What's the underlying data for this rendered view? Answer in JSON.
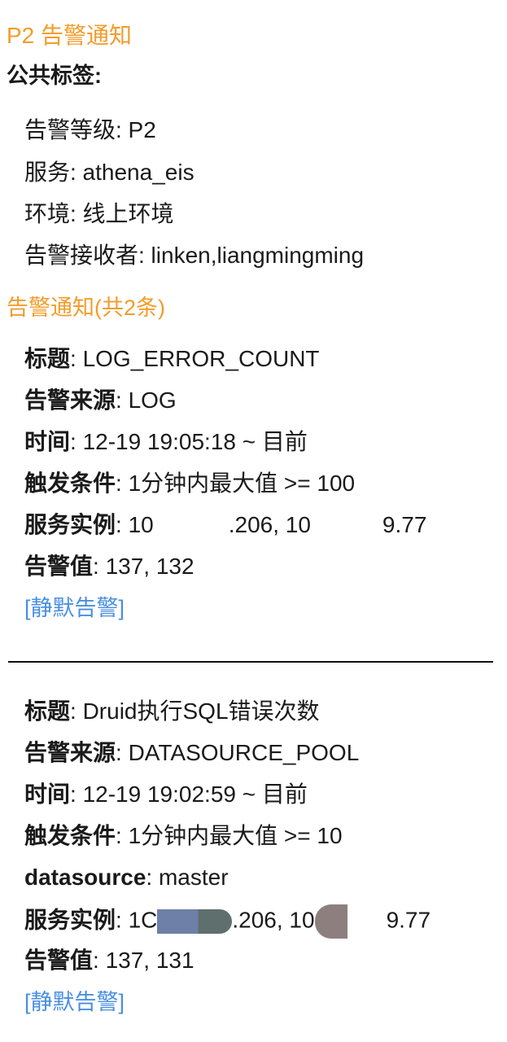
{
  "header": {
    "title": "P2 告警通知",
    "common_labels_heading": "公共标签:"
  },
  "common_labels": {
    "level_key": "告警等级:",
    "level_val": " P2",
    "service_key": "服务:",
    "service_val": " athena_eis",
    "env_key": "环境:",
    "env_val": " 线上环境",
    "receivers_key": "告警接收者:",
    "receivers_val": " linken,liangmingming"
  },
  "alerts_header": "告警通知(共2条)",
  "alerts": [
    {
      "title_key": "标题",
      "title_val": ": LOG_ERROR_COUNT",
      "source_key": "告警来源",
      "source_val": ": LOG",
      "time_key": "时间",
      "time_val": ": 12-19 19:05:18 ~ 目前",
      "cond_key": "触发条件",
      "cond_val": ": 1分钟内最大值 >= 100",
      "inst_key": "服务实例",
      "inst_val_a": ": 10",
      "inst_val_b": ".206, 10",
      "inst_val_c": "9.77",
      "value_key": "告警值",
      "value_val": ": 137, 132",
      "silence": "[静默告警]"
    },
    {
      "title_key": "标题",
      "title_val": ": Druid执行SQL错误次数",
      "source_key": "告警来源",
      "source_val": ": DATASOURCE_POOL",
      "time_key": "时间",
      "time_val": ": 12-19 19:02:59 ~ 目前",
      "cond_key": "触发条件",
      "cond_val": ": 1分钟内最大值 >= 10",
      "ds_key": "datasource",
      "ds_val": ": master",
      "inst_key": "服务实例",
      "inst_val_a": ": 1C",
      "inst_val_b": ".206, 10",
      "inst_val_c": "9.77",
      "value_key": "告警值",
      "value_val": ": 137, 131",
      "silence": "[静默告警]"
    }
  ],
  "colors": {
    "accent": "#f39c2a",
    "link": "#4a8fe0",
    "text": "#1a1a1a"
  }
}
